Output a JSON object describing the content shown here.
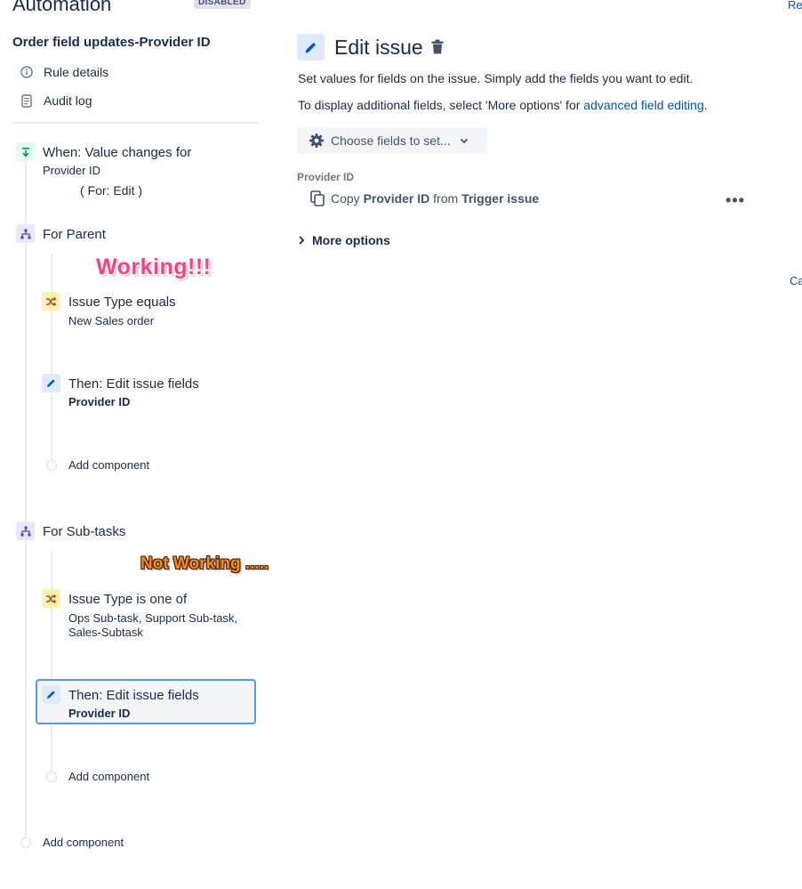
{
  "header": {
    "title": "Automation",
    "status": "DISABLED",
    "top_right_link": "Re",
    "right_link2": "Ca"
  },
  "rule": {
    "name": "Order field updates-Provider ID"
  },
  "menu": [
    {
      "label": "Rule details",
      "icon": "info-icon"
    },
    {
      "label": "Audit log",
      "icon": "document-icon"
    }
  ],
  "flow": {
    "trigger": {
      "title": "When: Value changes for",
      "sub": "Provider ID",
      "note": "( For: Edit )"
    },
    "parent_branch": {
      "title": "For Parent",
      "annotation": "Working!!!",
      "condition": {
        "title": "Issue Type equals",
        "sub": "New Sales order"
      },
      "action": {
        "title": "Then: Edit issue fields",
        "sub": "Provider ID"
      },
      "add": "Add component"
    },
    "subtask_branch": {
      "title": "For Sub-tasks",
      "annotation": "Not Working .....",
      "condition": {
        "title": "Issue Type is one of",
        "sub_line1": "Ops Sub-task, Support Sub-task,",
        "sub_line2": "Sales-Subtask"
      },
      "action": {
        "title": "Then: Edit issue fields",
        "sub": "Provider ID"
      },
      "add": "Add component"
    },
    "add_root": "Add component"
  },
  "panel": {
    "title": "Edit issue",
    "desc1": "Set values for fields on the issue. Simply add the fields you want to edit.",
    "desc2_pre": "To display additional fields, select 'More options' for ",
    "desc2_link": "advanced field editing",
    "desc2_post": ".",
    "choose_button": "Choose fields to set...",
    "field_label": "Provider ID",
    "copy": {
      "w1": "Copy",
      "field": "Provider ID",
      "w2": "from",
      "source": "Trigger issue"
    },
    "more_options": "More options"
  }
}
